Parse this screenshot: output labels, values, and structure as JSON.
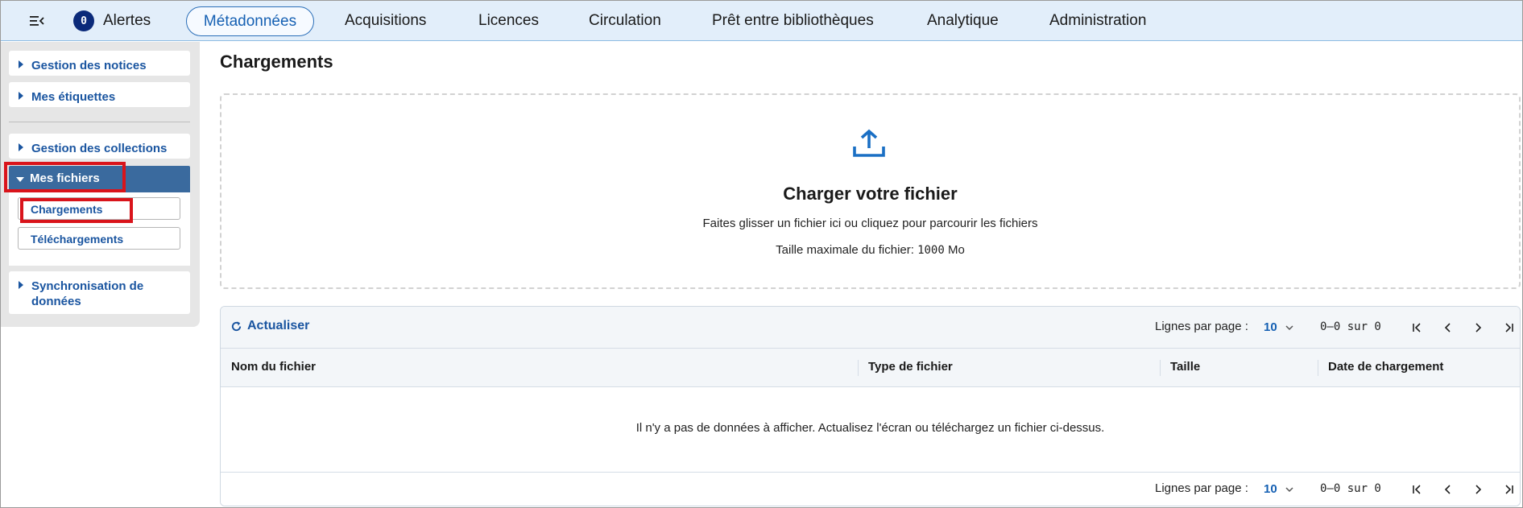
{
  "topnav": {
    "alert_count": "0",
    "alerts_label": "Alertes",
    "items": [
      "Métadonnées",
      "Acquisitions",
      "Licences",
      "Circulation",
      "Prêt entre bibliothèques",
      "Analytique",
      "Administration"
    ],
    "active": "Métadonnées"
  },
  "sidebar": {
    "items": [
      {
        "label": "Gestion des notices"
      },
      {
        "label": "Mes étiquettes"
      },
      {
        "label": "Gestion des collections"
      },
      {
        "label": "Mes fichiers"
      },
      {
        "label": "Synchronisation de données"
      }
    ],
    "submenu": [
      "Chargements",
      "Téléchargements"
    ]
  },
  "main": {
    "title": "Chargements",
    "dropzone": {
      "title": "Charger votre fichier",
      "instructions": "Faites glisser un fichier ici ou cliquez pour parcourir les fichiers",
      "max_size_prefix": "Taille maximale du fichier: ",
      "max_size_value": "1000",
      "max_size_unit": " Mo"
    },
    "table": {
      "refresh_label": "Actualiser",
      "rows_per_page_label": "Lignes par page :",
      "rows_per_page": "10",
      "range": "0–0 sur 0",
      "columns": [
        "Nom du fichier",
        "Type de fichier",
        "Taille",
        "Date de chargement"
      ],
      "empty_message": "Il n'y a pas de données à afficher. Actualisez l'écran ou téléchargez un fichier ci-dessus."
    }
  },
  "colors": {
    "nav_bg": "#e2eefa",
    "accent": "#1560b3",
    "sidebar_active": "#3a6a9e",
    "highlight": "#d9141b"
  },
  "icons": [
    "menu-collapse-icon",
    "upload-icon",
    "refresh-icon",
    "chevron-down-icon",
    "first-page-icon",
    "prev-page-icon",
    "next-page-icon",
    "last-page-icon",
    "caret-right-icon",
    "caret-down-icon"
  ]
}
